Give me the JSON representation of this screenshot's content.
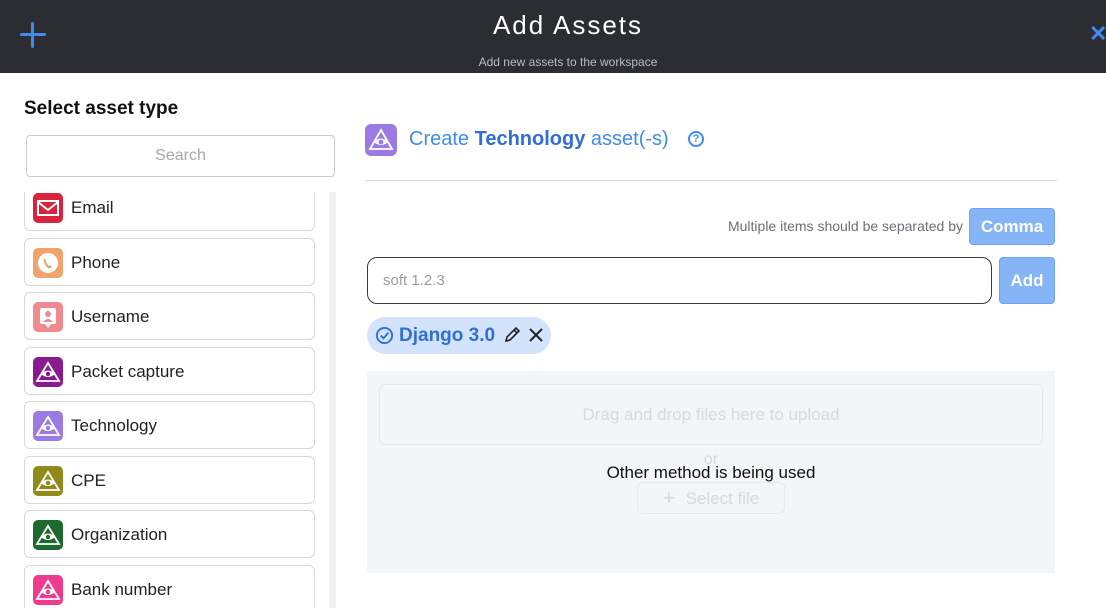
{
  "header": {
    "title": "Add Assets",
    "subtitle": "Add new assets to the workspace",
    "add_icon": "plus-icon",
    "close_icon": "close-icon",
    "close_glyph": "✕"
  },
  "sidebar": {
    "title": "Select asset type",
    "search_placeholder": "Search",
    "items": [
      {
        "label": "Email",
        "icon": "envelope-icon",
        "color": "#d8243f"
      },
      {
        "label": "Phone",
        "icon": "phone-icon",
        "color": "#f0a36b"
      },
      {
        "label": "Username",
        "icon": "user-icon",
        "color": "#f08a8e"
      },
      {
        "label": "Packet capture",
        "icon": "eye-pyramid-icon",
        "color": "#8a1a8f"
      },
      {
        "label": "Technology",
        "icon": "eye-pyramid-icon",
        "color": "#9b7be3"
      },
      {
        "label": "CPE",
        "icon": "eye-pyramid-icon",
        "color": "#8f8a1a"
      },
      {
        "label": "Organization",
        "icon": "eye-pyramid-icon",
        "color": "#1e6a2e"
      },
      {
        "label": "Bank number",
        "icon": "eye-pyramid-icon",
        "color": "#ee3b8f"
      }
    ]
  },
  "main": {
    "create_prefix": "Create ",
    "create_type": "Technology",
    "create_suffix": " asset(-s)",
    "help_glyph": "?",
    "separator_hint": "Multiple items should be separated by",
    "separator_button": "Comma",
    "input_placeholder": "soft 1.2.3",
    "add_button": "Add",
    "chips": [
      {
        "label": "Django 3.0"
      }
    ],
    "upload": {
      "drop_text": "Drag and drop files here to upload",
      "or_text": "or",
      "select_plus": "+",
      "select_file": "Select file",
      "overlay_message": "Other method is being used"
    }
  }
}
